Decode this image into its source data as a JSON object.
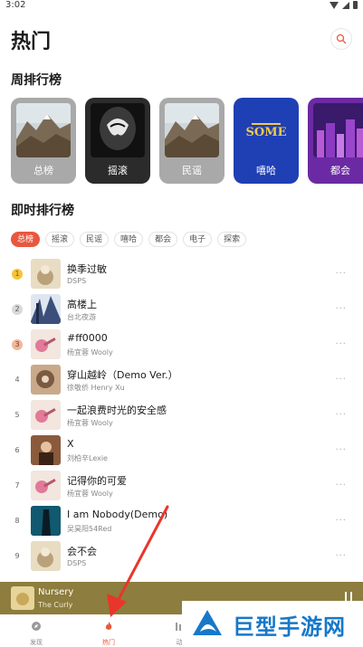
{
  "status_bar": {
    "time": "3:02"
  },
  "header": {
    "title": "热门"
  },
  "weekly": {
    "title": "周排行榜",
    "cards": [
      {
        "label": "总榜",
        "bg": "#a9a9a9"
      },
      {
        "label": "摇滚",
        "bg": "#2b2b2b"
      },
      {
        "label": "民谣",
        "bg": "#a9a9a9"
      },
      {
        "label": "嘻哈",
        "bg": "#1f3fb4"
      },
      {
        "label": "都会",
        "bg": "#6b2aa3"
      }
    ]
  },
  "realtime": {
    "title": "即时排行榜",
    "tabs": [
      "总榜",
      "摇滚",
      "民谣",
      "嘻哈",
      "都会",
      "电子",
      "探索"
    ],
    "active_tab": "总榜",
    "songs": [
      {
        "rank": "1",
        "title": "换季过敏",
        "artist": "DSPS"
      },
      {
        "rank": "2",
        "title": "高楼上",
        "artist": "台北夜游"
      },
      {
        "rank": "3",
        "title": "#ff0000",
        "artist": "杨宜蓉 Wooly"
      },
      {
        "rank": "4",
        "title": "穿山越岭（Demo Ver.）",
        "artist": "徐敬侨 Henry Xu"
      },
      {
        "rank": "5",
        "title": "一起浪费时光的安全感",
        "artist": "杨宜蓉 Wooly"
      },
      {
        "rank": "6",
        "title": "X",
        "artist": "刘柏辛Lexie"
      },
      {
        "rank": "7",
        "title": "记得你的可爱",
        "artist": "杨宜蓉 Wooly"
      },
      {
        "rank": "8",
        "title": "I am Nobody(Demo)",
        "artist": "吴昊阳54Red"
      },
      {
        "rank": "9",
        "title": "会不会",
        "artist": "DSPS"
      }
    ],
    "more_icon": "..."
  },
  "player": {
    "title": "Nursery",
    "artist": "The Curly"
  },
  "bottom_nav": [
    {
      "label": "发现",
      "icon": "compass-icon",
      "active": false
    },
    {
      "label": "热门",
      "icon": "flame-icon",
      "active": true
    },
    {
      "label": "动",
      "icon": "bars-icon",
      "active": false
    }
  ],
  "watermark": {
    "text": "巨型手游网"
  },
  "colors": {
    "accent": "#e9573f",
    "player_bg": "#8d7d3e",
    "watermark": "#1778c9"
  }
}
